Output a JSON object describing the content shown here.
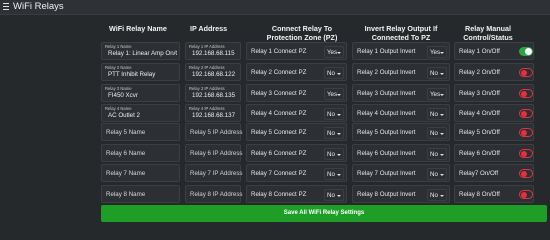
{
  "window": {
    "title": "WiFi Relays"
  },
  "headers": {
    "name": "WiFi Relay Name",
    "ip": "IP Address",
    "pz_line1": "Connect Relay To",
    "pz_line2": "Protection Zone (PZ)",
    "inv_line1": "Invert Relay Output If",
    "inv_line2": "Connected To PZ",
    "man_line1": "Relay Manual",
    "man_line2": "Control/Status"
  },
  "relays": [
    {
      "name_label": "Relay 1 Name",
      "name_value": "Relay 1: Linear Amp On/Off",
      "name_placeholder": "",
      "ip_label": "Relay 1 IP Address",
      "ip_value": "192.168.68.115",
      "ip_placeholder": "",
      "pz_label": "Relay 1 Connect PZ",
      "pz_value": "Yes",
      "inv_label": "Relay 1 Output Invert",
      "inv_value": "Yes",
      "man_label": "Relay 1 On/Off",
      "man_state": "on"
    },
    {
      "name_label": "Relay 2 Name",
      "name_value": "PTT Inhibit Relay",
      "name_placeholder": "",
      "ip_label": "Relay 2 IP Address",
      "ip_value": "192.168.68.122",
      "ip_placeholder": "",
      "pz_label": "Relay 2 Connect PZ",
      "pz_value": "No",
      "inv_label": "Relay 2 Output Invert",
      "inv_value": "No",
      "man_label": "Relay 2 On/Off",
      "man_state": "off"
    },
    {
      "name_label": "Relay 3 Name",
      "name_value": "FI450 Xcvr",
      "name_placeholder": "",
      "ip_label": "Relay 3 IP Address",
      "ip_value": "192.168.68.135",
      "ip_placeholder": "",
      "pz_label": "Relay 3 Connect PZ",
      "pz_value": "Yes",
      "inv_label": "Relay 3 Output Invert",
      "inv_value": "Yes",
      "man_label": "Relay 3 On/Off",
      "man_state": "off"
    },
    {
      "name_label": "Relay 4 Name",
      "name_value": "AC Outlet 2",
      "name_placeholder": "",
      "ip_label": "Relay 4 IP Address",
      "ip_value": "192.168.68.137",
      "ip_placeholder": "",
      "pz_label": "Relay 4 Connect PZ",
      "pz_value": "No",
      "inv_label": "Relay 4 Output Invert",
      "inv_value": "No",
      "man_label": "Relay 4 On/Off",
      "man_state": "off"
    },
    {
      "name_label": "",
      "name_value": "",
      "name_placeholder": "Relay 5 Name",
      "ip_label": "",
      "ip_value": "",
      "ip_placeholder": "Relay 5 IP Address",
      "pz_label": "Relay 5 Connect PZ",
      "pz_value": "No",
      "inv_label": "Relay 5 Output Invert",
      "inv_value": "No",
      "man_label": "Relay 5 On/Off",
      "man_state": "off"
    },
    {
      "name_label": "",
      "name_value": "",
      "name_placeholder": "Relay 6 Name",
      "ip_label": "",
      "ip_value": "",
      "ip_placeholder": "Relay 6 IP Address",
      "pz_label": "Relay 6 Connect PZ",
      "pz_value": "No",
      "inv_label": "Relay 6 Output Invert",
      "inv_value": "No",
      "man_label": "Relay 6 On/Off",
      "man_state": "off"
    },
    {
      "name_label": "",
      "name_value": "",
      "name_placeholder": "Relay 7 Name",
      "ip_label": "",
      "ip_value": "",
      "ip_placeholder": "Relay 7 IP Address",
      "pz_label": "Relay 7 Connect PZ",
      "pz_value": "No",
      "inv_label": "Relay 7 Output Invert",
      "inv_value": "No",
      "man_label": "Relay7 On/Off",
      "man_state": "off"
    },
    {
      "name_label": "",
      "name_value": "",
      "name_placeholder": "Relay 8 Name",
      "ip_label": "",
      "ip_value": "",
      "ip_placeholder": "Relay 8 IP Address",
      "pz_label": "Relay 8 Connect PZ",
      "pz_value": "No",
      "inv_label": "Relay 8 Output Invert",
      "inv_value": "No",
      "man_label": "Relay 8 On/Off",
      "man_state": "off"
    }
  ],
  "save_button": {
    "label": "Save All WiFi Relay Settings"
  },
  "colors": {
    "toggle_on": "#28a745",
    "toggle_off": "#e0323f",
    "save_button": "#1f9e27",
    "background": "#26292c"
  },
  "icons": {
    "menu": "hamburger-menu-icon"
  }
}
